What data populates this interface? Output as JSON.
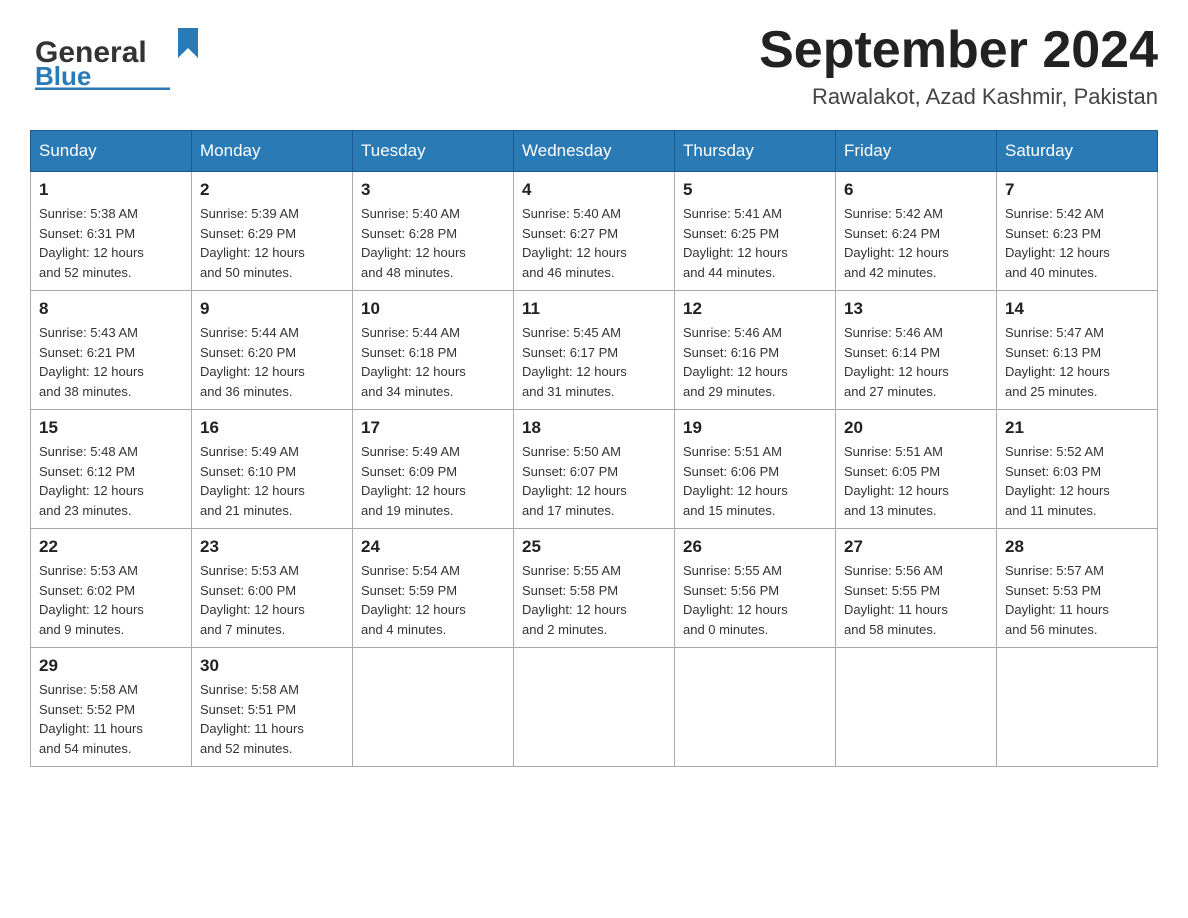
{
  "header": {
    "logo_general": "General",
    "logo_blue": "Blue",
    "month_title": "September 2024",
    "location": "Rawalakot, Azad Kashmir, Pakistan"
  },
  "weekdays": [
    "Sunday",
    "Monday",
    "Tuesday",
    "Wednesday",
    "Thursday",
    "Friday",
    "Saturday"
  ],
  "weeks": [
    [
      {
        "day": "1",
        "sunrise": "5:38 AM",
        "sunset": "6:31 PM",
        "daylight": "12 hours and 52 minutes."
      },
      {
        "day": "2",
        "sunrise": "5:39 AM",
        "sunset": "6:29 PM",
        "daylight": "12 hours and 50 minutes."
      },
      {
        "day": "3",
        "sunrise": "5:40 AM",
        "sunset": "6:28 PM",
        "daylight": "12 hours and 48 minutes."
      },
      {
        "day": "4",
        "sunrise": "5:40 AM",
        "sunset": "6:27 PM",
        "daylight": "12 hours and 46 minutes."
      },
      {
        "day": "5",
        "sunrise": "5:41 AM",
        "sunset": "6:25 PM",
        "daylight": "12 hours and 44 minutes."
      },
      {
        "day": "6",
        "sunrise": "5:42 AM",
        "sunset": "6:24 PM",
        "daylight": "12 hours and 42 minutes."
      },
      {
        "day": "7",
        "sunrise": "5:42 AM",
        "sunset": "6:23 PM",
        "daylight": "12 hours and 40 minutes."
      }
    ],
    [
      {
        "day": "8",
        "sunrise": "5:43 AM",
        "sunset": "6:21 PM",
        "daylight": "12 hours and 38 minutes."
      },
      {
        "day": "9",
        "sunrise": "5:44 AM",
        "sunset": "6:20 PM",
        "daylight": "12 hours and 36 minutes."
      },
      {
        "day": "10",
        "sunrise": "5:44 AM",
        "sunset": "6:18 PM",
        "daylight": "12 hours and 34 minutes."
      },
      {
        "day": "11",
        "sunrise": "5:45 AM",
        "sunset": "6:17 PM",
        "daylight": "12 hours and 31 minutes."
      },
      {
        "day": "12",
        "sunrise": "5:46 AM",
        "sunset": "6:16 PM",
        "daylight": "12 hours and 29 minutes."
      },
      {
        "day": "13",
        "sunrise": "5:46 AM",
        "sunset": "6:14 PM",
        "daylight": "12 hours and 27 minutes."
      },
      {
        "day": "14",
        "sunrise": "5:47 AM",
        "sunset": "6:13 PM",
        "daylight": "12 hours and 25 minutes."
      }
    ],
    [
      {
        "day": "15",
        "sunrise": "5:48 AM",
        "sunset": "6:12 PM",
        "daylight": "12 hours and 23 minutes."
      },
      {
        "day": "16",
        "sunrise": "5:49 AM",
        "sunset": "6:10 PM",
        "daylight": "12 hours and 21 minutes."
      },
      {
        "day": "17",
        "sunrise": "5:49 AM",
        "sunset": "6:09 PM",
        "daylight": "12 hours and 19 minutes."
      },
      {
        "day": "18",
        "sunrise": "5:50 AM",
        "sunset": "6:07 PM",
        "daylight": "12 hours and 17 minutes."
      },
      {
        "day": "19",
        "sunrise": "5:51 AM",
        "sunset": "6:06 PM",
        "daylight": "12 hours and 15 minutes."
      },
      {
        "day": "20",
        "sunrise": "5:51 AM",
        "sunset": "6:05 PM",
        "daylight": "12 hours and 13 minutes."
      },
      {
        "day": "21",
        "sunrise": "5:52 AM",
        "sunset": "6:03 PM",
        "daylight": "12 hours and 11 minutes."
      }
    ],
    [
      {
        "day": "22",
        "sunrise": "5:53 AM",
        "sunset": "6:02 PM",
        "daylight": "12 hours and 9 minutes."
      },
      {
        "day": "23",
        "sunrise": "5:53 AM",
        "sunset": "6:00 PM",
        "daylight": "12 hours and 7 minutes."
      },
      {
        "day": "24",
        "sunrise": "5:54 AM",
        "sunset": "5:59 PM",
        "daylight": "12 hours and 4 minutes."
      },
      {
        "day": "25",
        "sunrise": "5:55 AM",
        "sunset": "5:58 PM",
        "daylight": "12 hours and 2 minutes."
      },
      {
        "day": "26",
        "sunrise": "5:55 AM",
        "sunset": "5:56 PM",
        "daylight": "12 hours and 0 minutes."
      },
      {
        "day": "27",
        "sunrise": "5:56 AM",
        "sunset": "5:55 PM",
        "daylight": "11 hours and 58 minutes."
      },
      {
        "day": "28",
        "sunrise": "5:57 AM",
        "sunset": "5:53 PM",
        "daylight": "11 hours and 56 minutes."
      }
    ],
    [
      {
        "day": "29",
        "sunrise": "5:58 AM",
        "sunset": "5:52 PM",
        "daylight": "11 hours and 54 minutes."
      },
      {
        "day": "30",
        "sunrise": "5:58 AM",
        "sunset": "5:51 PM",
        "daylight": "11 hours and 52 minutes."
      },
      null,
      null,
      null,
      null,
      null
    ]
  ],
  "labels": {
    "sunrise": "Sunrise: ",
    "sunset": "Sunset: ",
    "daylight": "Daylight: "
  }
}
